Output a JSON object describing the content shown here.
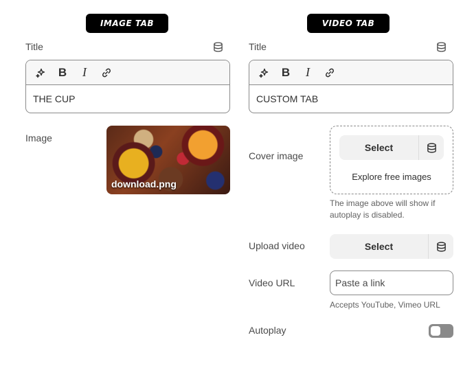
{
  "image_tab": {
    "badge": "IMAGE TAB",
    "title_label": "Title",
    "title_value": "THE CUP",
    "image_label": "Image",
    "image_filename": "download.png"
  },
  "video_tab": {
    "badge": "VIDEO TAB",
    "title_label": "Title",
    "title_value": "CUSTOM TAB",
    "cover_image_label": "Cover image",
    "cover_select_label": "Select",
    "explore_label": "Explore free images",
    "cover_helper": "The image above will show if autoplay is disabled.",
    "upload_video_label": "Upload video",
    "upload_select_label": "Select",
    "video_url_label": "Video URL",
    "video_url_placeholder": "Paste a link",
    "video_url_helper": "Accepts YouTube, Vimeo URL",
    "autoplay_label": "Autoplay",
    "autoplay_on": false
  },
  "icons": {
    "dynamic_source": "database-icon",
    "magic": "sparkle-icon",
    "bold": "bold-icon",
    "italic": "italic-icon",
    "link": "link-icon"
  },
  "colors": {
    "badge_bg": "#000000",
    "border": "#8a8a8a",
    "button_bg": "#f1f1f1",
    "toggle_off": "#8a8a8a",
    "text": "#303030"
  }
}
